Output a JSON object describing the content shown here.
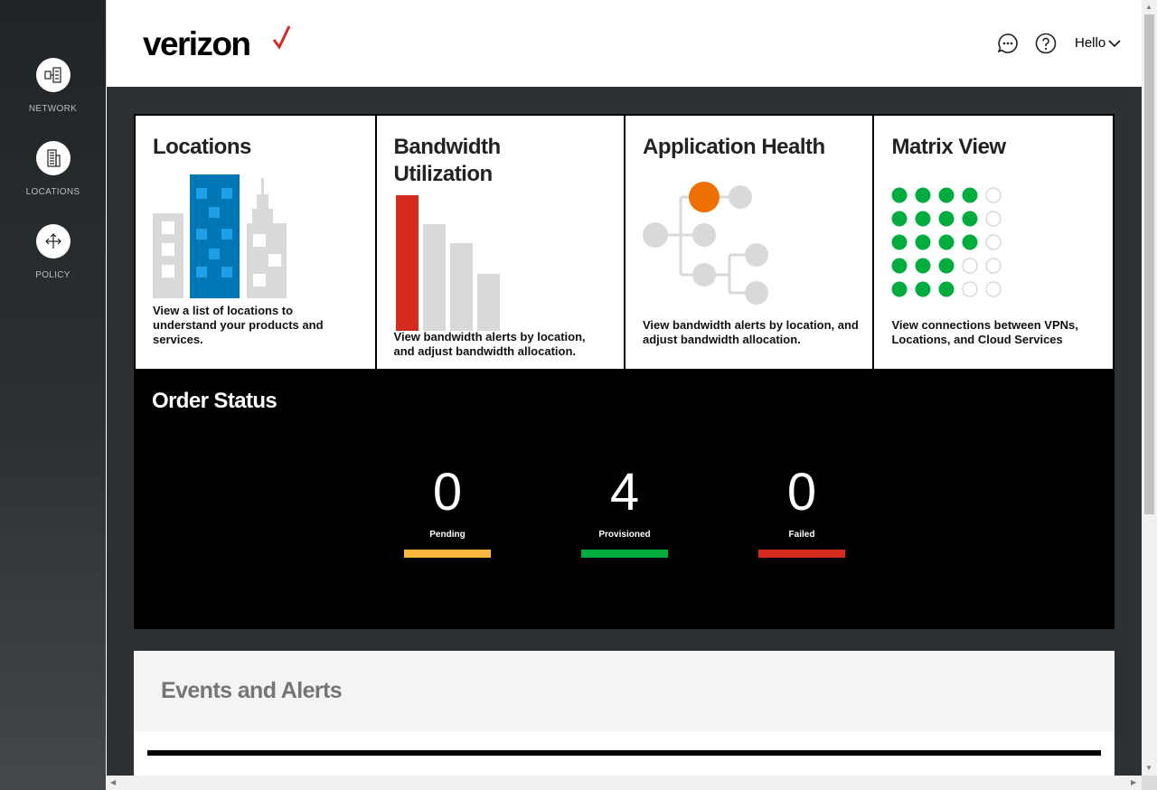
{
  "sidebar": {
    "items": [
      {
        "label": "NETWORK",
        "icon": "network-icon"
      },
      {
        "label": "LOCATIONS",
        "icon": "building-icon"
      },
      {
        "label": "POLICY",
        "icon": "move-icon"
      }
    ]
  },
  "header": {
    "logo_text": "verizon",
    "greeting": "Hello",
    "icons": [
      "chat-icon",
      "help-icon",
      "chevron-down-icon"
    ]
  },
  "cards": [
    {
      "title": "Locations",
      "description": "View a list of locations to understand your products and services."
    },
    {
      "title": "Bandwidth Utilization",
      "description": "View bandwidth alerts by location, and adjust bandwidth allocation."
    },
    {
      "title": "Application Health",
      "description": "View bandwidth alerts by location, and adjust bandwidth allocation."
    },
    {
      "title": "Matrix View",
      "description": "View connections between VPNs, Locations, and Cloud Services"
    }
  ],
  "order_status": {
    "title": "Order Status",
    "stats": [
      {
        "value": "0",
        "label": "Pending",
        "color": "#fbb63e"
      },
      {
        "value": "4",
        "label": "Provisioned",
        "color": "#00ac3e"
      },
      {
        "value": "0",
        "label": "Failed",
        "color": "#d52b1e"
      }
    ]
  },
  "events": {
    "title": "Events and Alerts"
  },
  "colors": {
    "brand_red": "#d52b1e",
    "accent_orange": "#ed7000",
    "accent_blue": "#0077b4",
    "status_green": "#00ac3e",
    "light_gray": "#d8dada"
  }
}
